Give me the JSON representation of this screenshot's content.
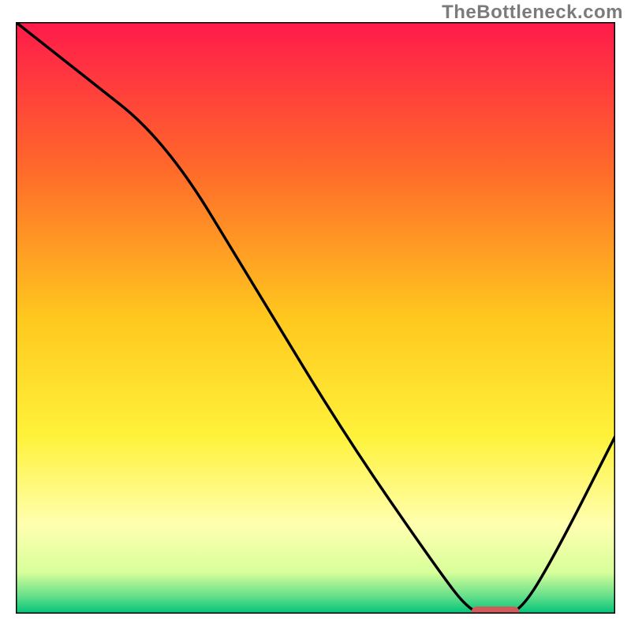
{
  "watermark": "TheBottleneck.com",
  "chart_data": {
    "type": "line",
    "title": "",
    "xlabel": "",
    "ylabel": "",
    "xlim": [
      0,
      100
    ],
    "ylim": [
      0,
      100
    ],
    "gradient_stops": [
      {
        "offset": 0,
        "color": "#ff1a4b"
      },
      {
        "offset": 25,
        "color": "#ff6a2a"
      },
      {
        "offset": 50,
        "color": "#ffc81e"
      },
      {
        "offset": 70,
        "color": "#fff23a"
      },
      {
        "offset": 85,
        "color": "#ffffb0"
      },
      {
        "offset": 93,
        "color": "#d8ff9a"
      },
      {
        "offset": 97,
        "color": "#66e08a"
      },
      {
        "offset": 100,
        "color": "#00c37a"
      }
    ],
    "series": [
      {
        "name": "bottleneck-curve",
        "color": "#000000",
        "x": [
          0,
          10,
          25,
          40,
          55,
          70,
          76,
          80,
          84,
          90,
          100
        ],
        "values": [
          100,
          92,
          80,
          55,
          30,
          8,
          0,
          0,
          0,
          10,
          30
        ]
      }
    ],
    "marker": {
      "name": "optimal-range",
      "x_start": 76,
      "x_end": 84,
      "y": 0,
      "color": "#d15a5a"
    },
    "axes": {
      "show_border": true,
      "border_color": "#000000",
      "border_width": 3
    }
  }
}
